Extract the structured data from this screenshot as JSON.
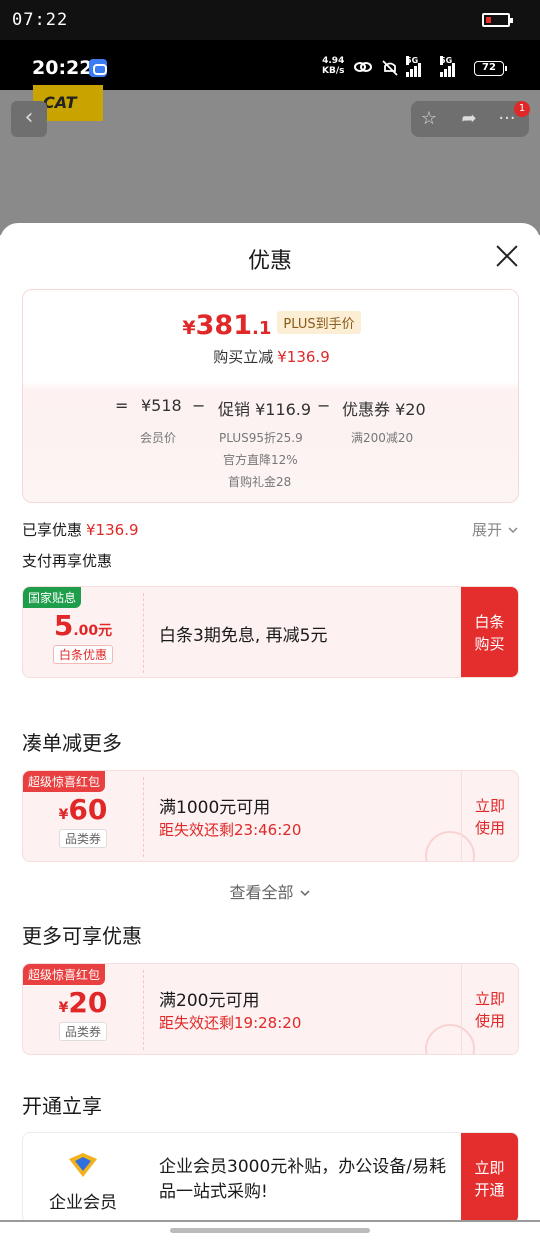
{
  "outer_status": {
    "time": "07:22"
  },
  "phone_status": {
    "time": "20:22",
    "speed_top": "4.94",
    "speed_bottom": "KB/s",
    "net1": "5G",
    "net2": "5G",
    "battery": "72"
  },
  "background": {
    "brand": "CAT",
    "badge_count": "1"
  },
  "sheet": {
    "title": "优惠",
    "summary": {
      "price_symbol": "¥",
      "price_int": "381",
      "price_dec": ".1",
      "plus_label": "PLUS到手价",
      "reduce_label": "购买立减",
      "reduce_value": "¥136.9",
      "eq": "=",
      "member_price": "¥518",
      "member_label": "会员价",
      "minus1": "−",
      "promo": "促销 ¥116.9",
      "promo_sub1": "PLUS95折25.9",
      "promo_sub2": "官方直降12%",
      "promo_sub3": "首购礼金28",
      "minus2": "−",
      "coupon": "优惠券 ¥20",
      "coupon_sub": "满200减20"
    },
    "enjoyed_label": "已享优惠",
    "enjoyed_value": "¥136.9",
    "expand_label": "展开",
    "pay_more_label": "支付再享优惠",
    "baitiao": {
      "tag": "国家贴息",
      "amount_int": "5",
      "amount_dec": ".00元",
      "small_tag": "白条优惠",
      "text": "白条3期免息, 再减5元",
      "action_line1": "白条",
      "action_line2": "购买"
    },
    "section1_title": "凑单减更多",
    "coupon1": {
      "tag": "超级惊喜红包",
      "symbol": "¥",
      "amount": "60",
      "type": "品类券",
      "condition": "满1000元可用",
      "timer": "距失效还剩23:46:20",
      "action_line1": "立即",
      "action_line2": "使用"
    },
    "view_all": "查看全部",
    "section2_title": "更多可享优惠",
    "coupon2": {
      "tag": "超级惊喜红包",
      "symbol": "¥",
      "amount": "20",
      "type": "品类券",
      "condition": "满200元可用",
      "timer": "距失效还剩19:28:20",
      "action_line1": "立即",
      "action_line2": "使用"
    },
    "section3_title": "开通立享",
    "member": {
      "name": "企业会员",
      "desc": "企业会员3000元补贴，办公设备/易耗品一站式采购!",
      "action_line1": "立即",
      "action_line2": "开通"
    }
  },
  "colors": {
    "accent_red": "#e02828",
    "green_tag": "#1e9e4a"
  },
  "icons": [
    "back-icon",
    "star-icon",
    "share-icon",
    "more-icon",
    "close-icon",
    "chevron-down-icon",
    "enterprise-logo-icon"
  ]
}
